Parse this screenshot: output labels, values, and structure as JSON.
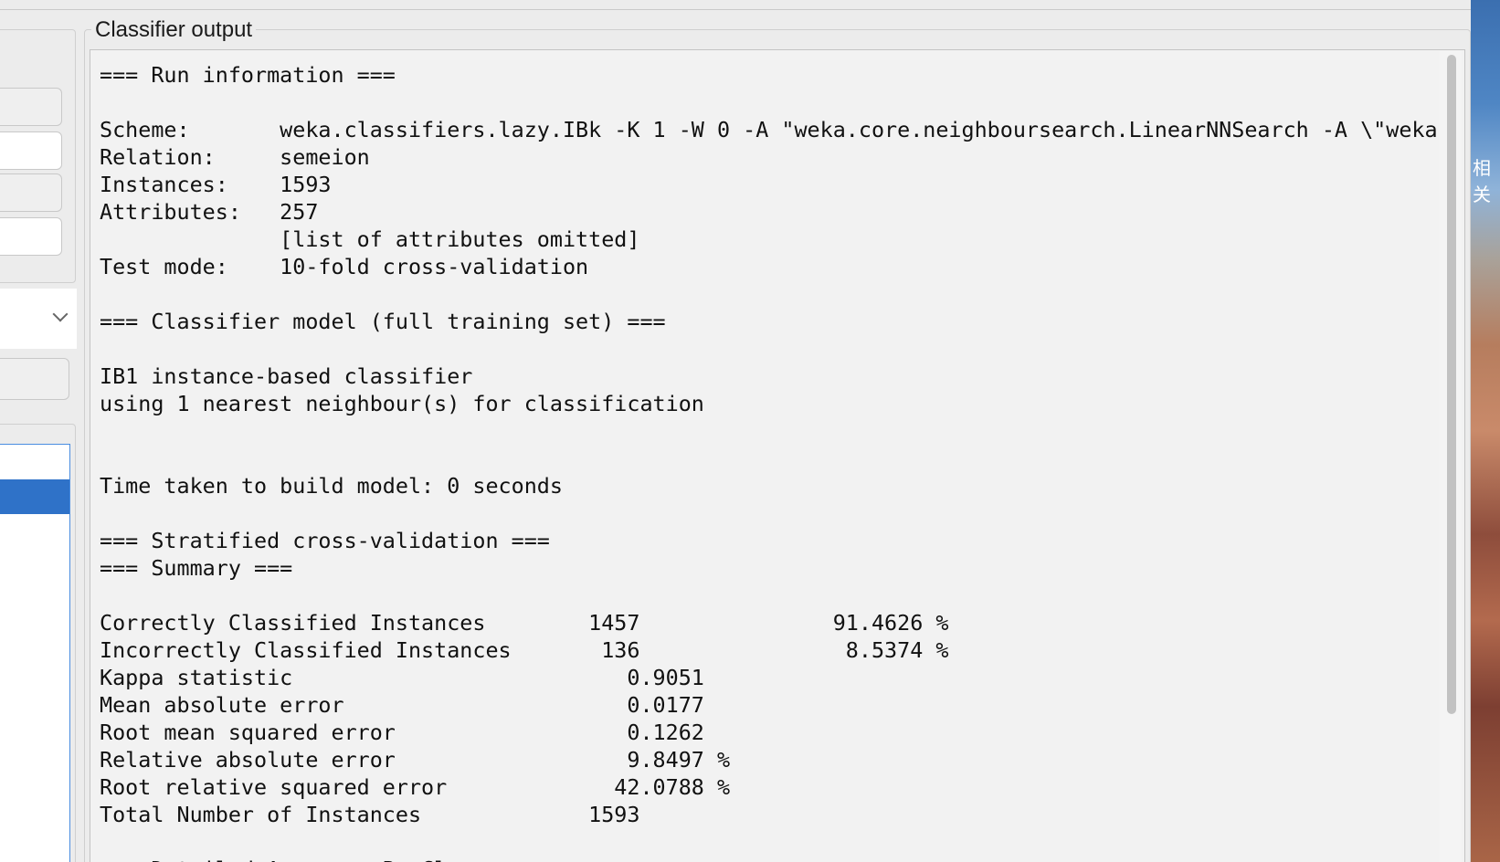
{
  "window": {
    "panel_title": "Classifier output"
  },
  "output": {
    "lines": [
      "=== Run information ===",
      "",
      "Scheme:       weka.classifiers.lazy.IBk -K 1 -W 0 -A \"weka.core.neighboursearch.LinearNNSearch -A \\\"weka.",
      "Relation:     semeion",
      "Instances:    1593",
      "Attributes:   257",
      "              [list of attributes omitted]",
      "Test mode:    10-fold cross-validation",
      "",
      "=== Classifier model (full training set) ===",
      "",
      "IB1 instance-based classifier",
      "using 1 nearest neighbour(s) for classification",
      "",
      "",
      "Time taken to build model: 0 seconds",
      "",
      "=== Stratified cross-validation ===",
      "=== Summary ===",
      "",
      "Correctly Classified Instances        1457               91.4626 %",
      "Incorrectly Classified Instances       136                8.5374 %",
      "Kappa statistic                          0.9051",
      "Mean absolute error                      0.0177",
      "Root mean squared error                  0.1262",
      "Relative absolute error                  9.8497 %",
      "Root relative squared error             42.0788 %",
      "Total Number of Instances             1593",
      "",
      "=== Detailed Accuracy By Class ==="
    ]
  },
  "desktop": {
    "edge_text": "相关"
  },
  "colors": {
    "window_bg": "#ececec",
    "output_bg": "#f2f2f2",
    "selection": "#2f72c8",
    "list_border": "#4a8de0"
  }
}
